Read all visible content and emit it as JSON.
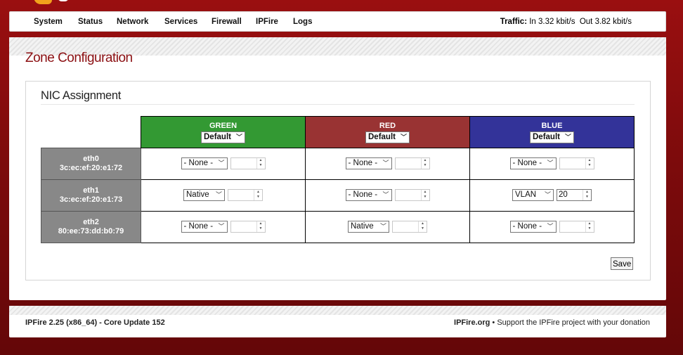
{
  "nav": {
    "items": [
      "System",
      "Status",
      "Network",
      "Services",
      "Firewall",
      "IPFire",
      "Logs"
    ],
    "traffic_label": "Traffic:",
    "traffic_in": "In 3.32 kbit/s",
    "traffic_out": "Out 3.82 kbit/s"
  },
  "page": {
    "title": "Zone Configuration",
    "section_title": "NIC Assignment",
    "save_label": "Save"
  },
  "zones": [
    {
      "name": "GREEN",
      "mode": "Default",
      "color": "#339933"
    },
    {
      "name": "RED",
      "mode": "Default",
      "color": "#993333"
    },
    {
      "name": "BLUE",
      "mode": "Default",
      "color": "#333399"
    }
  ],
  "nics": [
    {
      "name": "eth0",
      "mac": "3c:ec:ef:20:e1:72",
      "cells": [
        {
          "mode": "- None -",
          "vlan": ""
        },
        {
          "mode": "- None -",
          "vlan": ""
        },
        {
          "mode": "- None -",
          "vlan": ""
        }
      ]
    },
    {
      "name": "eth1",
      "mac": "3c:ec:ef:20:e1:73",
      "cells": [
        {
          "mode": "Native",
          "vlan": ""
        },
        {
          "mode": "- None -",
          "vlan": ""
        },
        {
          "mode": "VLAN",
          "vlan": "20"
        }
      ]
    },
    {
      "name": "eth2",
      "mac": "80:ee:73:dd:b0:79",
      "cells": [
        {
          "mode": "- None -",
          "vlan": ""
        },
        {
          "mode": "Native",
          "vlan": ""
        },
        {
          "mode": "- None -",
          "vlan": ""
        }
      ]
    }
  ],
  "footer": {
    "version": "IPFire 2.25 (x86_64) - Core Update 152",
    "site": "IPFire.org",
    "support": " • Support the IPFire project with your donation"
  },
  "colors": {
    "accent": "#8b0f12",
    "background": "#7d0b0c"
  }
}
